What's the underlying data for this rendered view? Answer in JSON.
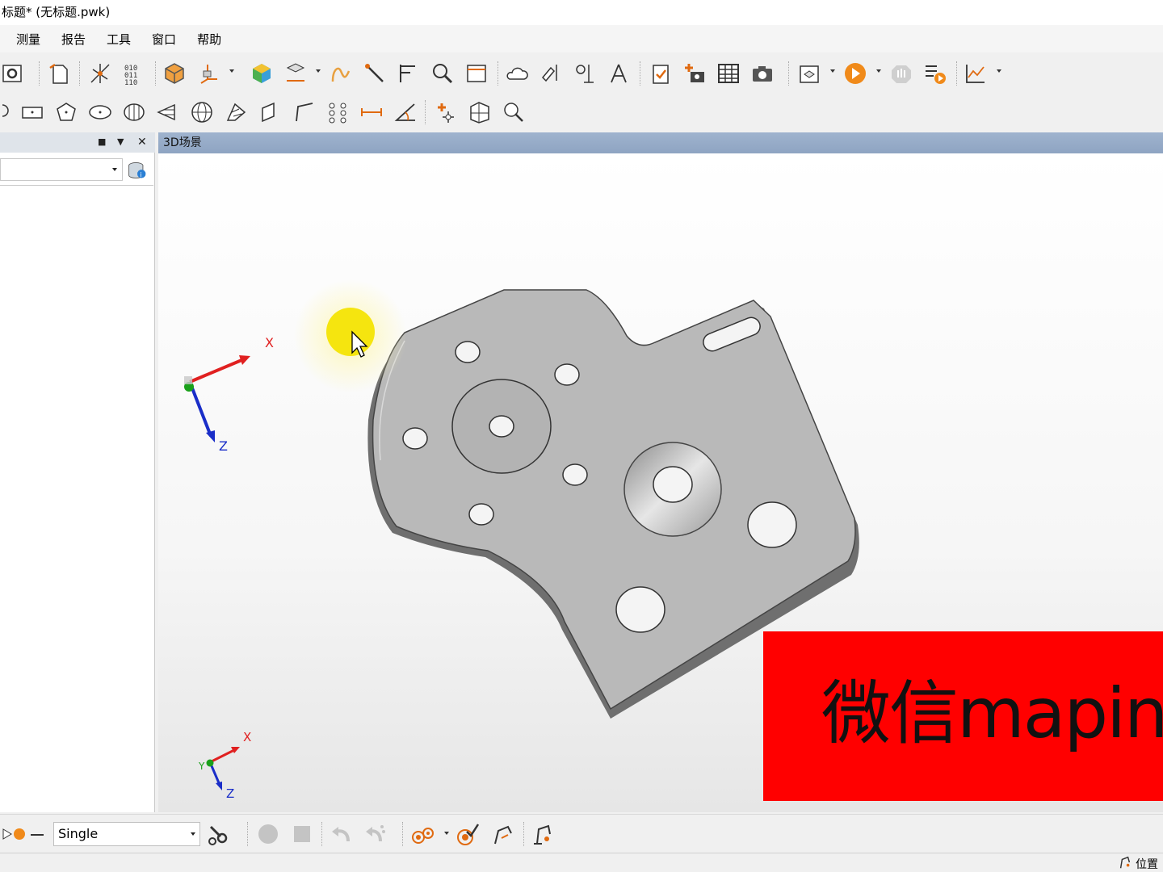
{
  "window": {
    "title": "标题* (无标题.pwk)"
  },
  "menu": [
    "测量",
    "报告",
    "工具",
    "窗口",
    "帮助"
  ],
  "panel": {
    "combo_value": ""
  },
  "scene": {
    "tab_label": "3D场景",
    "axis_x": "X",
    "axis_z": "Z",
    "mini_axis_x": "X",
    "mini_axis_y": "Y",
    "mini_axis_z": "Z"
  },
  "overlay": {
    "text": "微信maping"
  },
  "bottom": {
    "mode_value": "Single"
  },
  "status": {
    "position_label": "位置"
  },
  "colors": {
    "scene_header": "#9fb3ce",
    "red_overlay": "#ff0000",
    "part": "#b8b8b8",
    "cursor_halo": "#f5e50f"
  }
}
